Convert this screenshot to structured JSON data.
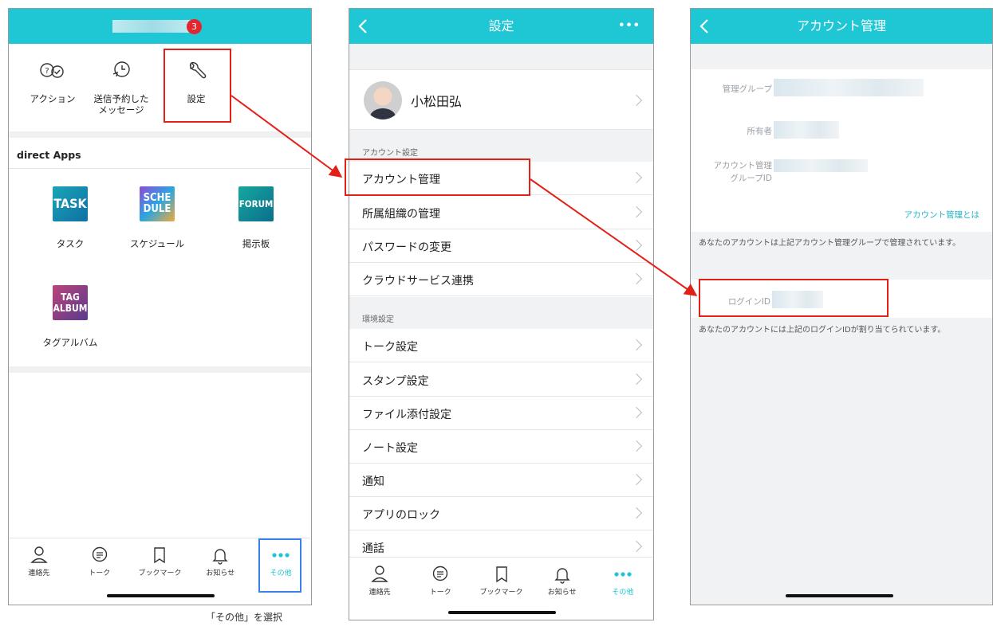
{
  "screens": {
    "home": {
      "badge_count": "3",
      "quick_actions": [
        {
          "label": "アクション",
          "icon": "action-icon"
        },
        {
          "label": "送信予約した\nメッセージ",
          "icon": "clock-icon"
        },
        {
          "label": "設定",
          "icon": "wrench-icon"
        }
      ],
      "apps_section_title": "direct Apps",
      "apps": [
        {
          "tile": "TASK",
          "label": "タスク"
        },
        {
          "tile": "SCHE\nDULE",
          "label": "スケジュール"
        },
        {
          "tile": "FORUM",
          "label": "掲示板"
        },
        {
          "tile": "TAG\nALBUM",
          "label": "タグアルバム"
        }
      ]
    },
    "settings": {
      "title": "設定",
      "more": "•••",
      "profile_name": "小松田弘",
      "section_account": "アカウント設定",
      "account_items": [
        "アカウント管理",
        "所属組織の管理",
        "パスワードの変更",
        "クラウドサービス連携"
      ],
      "section_env": "環境設定",
      "env_items": [
        "トーク設定",
        "スタンプ設定",
        "ファイル添付設定",
        "ノート設定",
        "通知",
        "アプリのロック",
        "通話"
      ]
    },
    "account": {
      "title": "アカウント管理",
      "label_group": "管理グループ",
      "label_owner": "所有者",
      "label_group_id_1": "アカウント管理",
      "label_group_id_2": "グループID",
      "link_about": "アカウント管理とは",
      "note_group": "あなたのアカウントは上記アカウント管理グループで管理されています。",
      "label_login": "ログインID",
      "note_login": "あなたのアカウントには上記のログインIDが割り当てられています。"
    }
  },
  "tabbar": [
    {
      "label": "連絡先",
      "icon": "person-icon"
    },
    {
      "label": "トーク",
      "icon": "chat-icon"
    },
    {
      "label": "ブックマーク",
      "icon": "bookmark-icon"
    },
    {
      "label": "お知らせ",
      "icon": "bell-icon"
    },
    {
      "label": "その他",
      "icon": "more-icon"
    }
  ],
  "caption": "「その他」を選択",
  "colors": {
    "accent": "#1fc6d4",
    "highlight_red": "#e32018",
    "highlight_blue": "#3b82e6"
  }
}
